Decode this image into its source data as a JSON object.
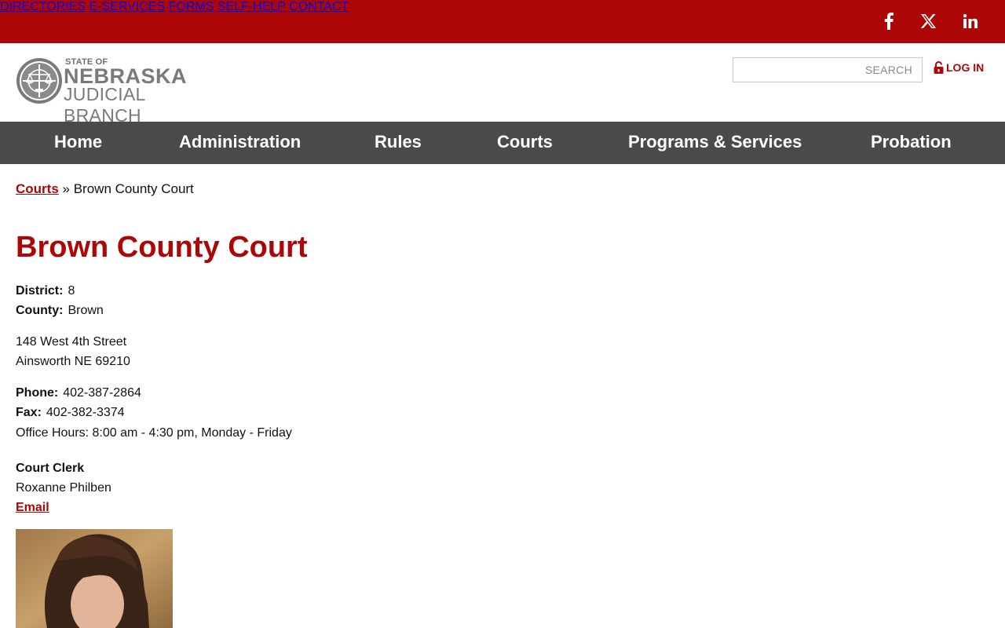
{
  "top_nav": {
    "items": [
      "DIRECTORIES",
      "E-SERVICES",
      "FORMS",
      "SELF-HELP",
      "CONTACT"
    ],
    "social": [
      "facebook-icon",
      "x-icon",
      "linkedin-icon"
    ]
  },
  "header": {
    "logo": {
      "state_of": "STATE OF",
      "nebraska": "NEBRASKA",
      "judicial": "JUDICIAL BRANCH"
    },
    "search_placeholder": "SEARCH",
    "login_label": "LOG IN"
  },
  "main_nav": [
    "Home",
    "Administration",
    "Rules",
    "Courts",
    "Programs & Services",
    "Probation"
  ],
  "breadcrumb": {
    "link": "Courts",
    "separator": "»",
    "current": "Brown County Court"
  },
  "court": {
    "title": "Brown County Court",
    "district_label": "District:",
    "district": "8",
    "county_label": "County:",
    "county": "Brown",
    "address_line1": "148 West 4th Street",
    "address_line2": "Ainsworth NE 69210",
    "phone_label": "Phone:",
    "phone": "402-387-2864",
    "fax_label": "Fax:",
    "fax": "402-382-3374",
    "office_hours": "Office Hours: 8:00 am - 4:30 pm, Monday - Friday",
    "clerk_heading": "Court Clerk",
    "clerk_name": "Roxanne Philben",
    "email_label": "Email"
  },
  "colors": {
    "brand_red": "#ad0606",
    "nav_gray": "#4a4a4a"
  }
}
